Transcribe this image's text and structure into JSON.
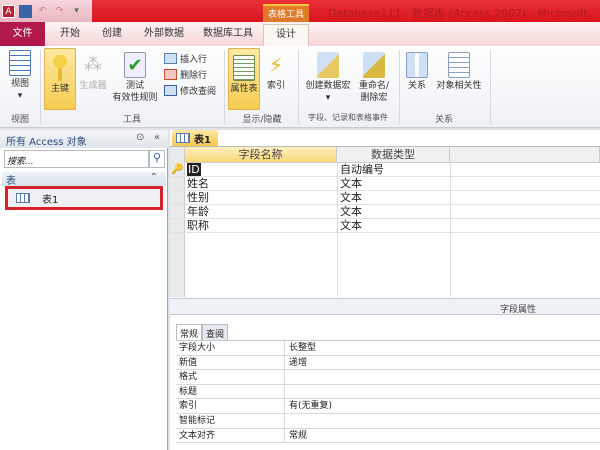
{
  "title_bar": {
    "app_icon": "A",
    "context_tab": "表格工具",
    "window_title": "Database111 : 数据库 (Access 2007) - Microsoft"
  },
  "tabs": [
    "文件",
    "开始",
    "创建",
    "外部数据",
    "数据库工具",
    "设计"
  ],
  "ribbon": {
    "view": {
      "label": "视图",
      "arrow": "▾",
      "group": "视图"
    },
    "tools": {
      "primary_key": "主键",
      "builder": "生成器",
      "test_rules": "测试有效性规则",
      "test_line1": "测试",
      "test_line2": "有效性规则",
      "insert_row": "插入行",
      "delete_row": "删除行",
      "modify_lookup": "修改查阅",
      "group": "工具"
    },
    "showhide": {
      "property_sheet": "属性表",
      "indexes": "索引",
      "group": "显示/隐藏"
    },
    "events": {
      "create_macro": "创建数据宏",
      "create_arrow": "▾",
      "rename_line1": "重命名/",
      "rename_line2": "删除宏",
      "group": "字段、记录和表格事件"
    },
    "relationships": {
      "relationships": "关系",
      "dependencies": "对象相关性",
      "group": "关系"
    }
  },
  "nav": {
    "header": "所有 Access 对象",
    "search_placeholder": "搜索...",
    "group": "表",
    "items": [
      "表1"
    ]
  },
  "document": {
    "tab": "表1",
    "columns": [
      "字段名称",
      "数据类型"
    ],
    "rows": [
      [
        "ID",
        "自动编号"
      ],
      [
        "姓名",
        "文本"
      ],
      [
        "性别",
        "文本"
      ],
      [
        "年龄",
        "文本"
      ],
      [
        "职称",
        "文本"
      ]
    ],
    "field_properties_label": "字段属性",
    "prop_tabs": [
      "常规",
      "查阅"
    ],
    "props": [
      [
        "字段大小",
        "长整型"
      ],
      [
        "新值",
        "递增"
      ],
      [
        "格式",
        ""
      ],
      [
        "标题",
        ""
      ],
      [
        "索引",
        "有(无重复)"
      ],
      [
        "智能标记",
        ""
      ],
      [
        "文本对齐",
        "常规"
      ]
    ]
  }
}
